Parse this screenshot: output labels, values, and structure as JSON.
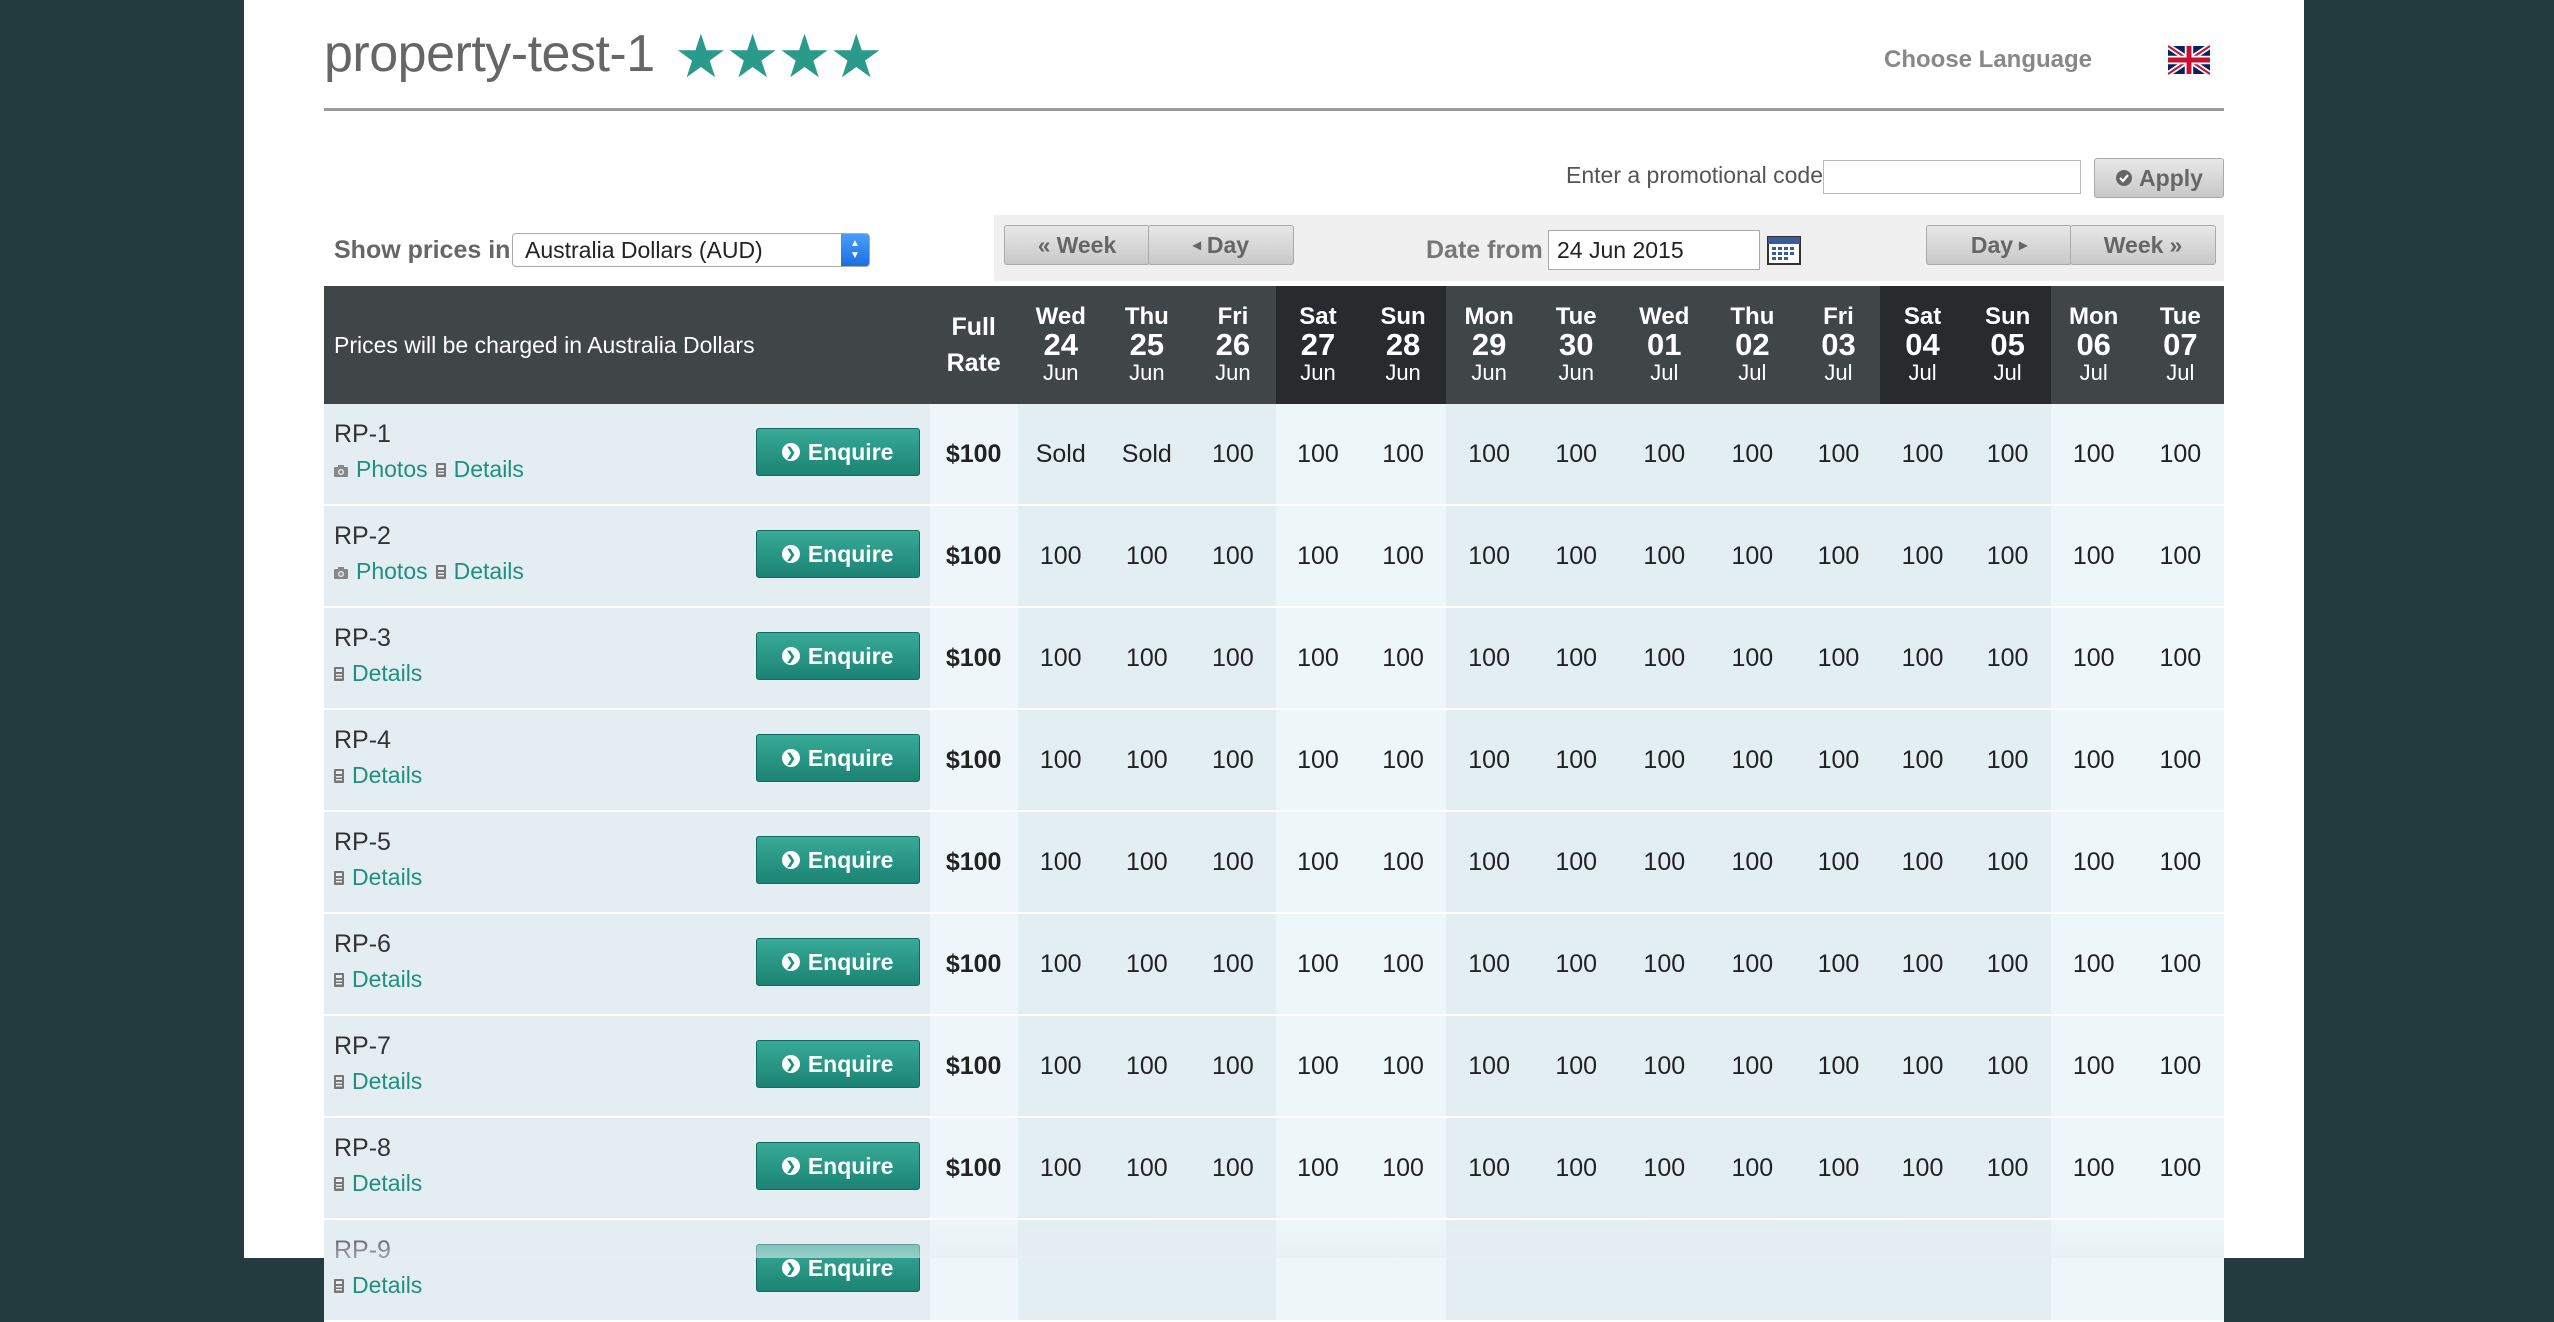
{
  "property": {
    "name": "property-test-1",
    "stars": "★★★★"
  },
  "language": {
    "label": "Choose Language",
    "flag_icon": "uk-flag-icon"
  },
  "promo": {
    "label": "Enter a promotional code",
    "value": "",
    "apply_label": "Apply"
  },
  "currency": {
    "label": "Show prices in",
    "selected": "Australia Dollars (AUD)"
  },
  "nav": {
    "week_back": "Week",
    "day_back": "Day",
    "date_from_label": "Date from",
    "date_from_value": "24 Jun 2015",
    "day_forward": "Day",
    "week_forward": "Week"
  },
  "table": {
    "notice": "Prices will be charged in Australia Dollars",
    "full_rate_label_1": "Full",
    "full_rate_label_2": "Rate",
    "dates": [
      {
        "dow": "Wed",
        "day": "24",
        "mon": "Jun",
        "weekend": false
      },
      {
        "dow": "Thu",
        "day": "25",
        "mon": "Jun",
        "weekend": false
      },
      {
        "dow": "Fri",
        "day": "26",
        "mon": "Jun",
        "weekend": false
      },
      {
        "dow": "Sat",
        "day": "27",
        "mon": "Jun",
        "weekend": true
      },
      {
        "dow": "Sun",
        "day": "28",
        "mon": "Jun",
        "weekend": true
      },
      {
        "dow": "Mon",
        "day": "29",
        "mon": "Jun",
        "weekend": false
      },
      {
        "dow": "Tue",
        "day": "30",
        "mon": "Jun",
        "weekend": false
      },
      {
        "dow": "Wed",
        "day": "01",
        "mon": "Jul",
        "weekend": false
      },
      {
        "dow": "Thu",
        "day": "02",
        "mon": "Jul",
        "weekend": false
      },
      {
        "dow": "Fri",
        "day": "03",
        "mon": "Jul",
        "weekend": false
      },
      {
        "dow": "Sat",
        "day": "04",
        "mon": "Jul",
        "weekend": true
      },
      {
        "dow": "Sun",
        "day": "05",
        "mon": "Jul",
        "weekend": true
      },
      {
        "dow": "Mon",
        "day": "06",
        "mon": "Jul",
        "weekend": false
      },
      {
        "dow": "Tue",
        "day": "07",
        "mon": "Jul",
        "weekend": false
      }
    ],
    "enquire_label": "Enquire",
    "photos_label": "Photos",
    "details_label": "Details",
    "rows": [
      {
        "name": "RP-1",
        "photos": true,
        "full_rate": "$100",
        "prices": [
          "Sold",
          "Sold",
          "100",
          "100",
          "100",
          "100",
          "100",
          "100",
          "100",
          "100",
          "100",
          "100",
          "100",
          "100"
        ]
      },
      {
        "name": "RP-2",
        "photos": true,
        "full_rate": "$100",
        "prices": [
          "100",
          "100",
          "100",
          "100",
          "100",
          "100",
          "100",
          "100",
          "100",
          "100",
          "100",
          "100",
          "100",
          "100"
        ]
      },
      {
        "name": "RP-3",
        "photos": false,
        "full_rate": "$100",
        "prices": [
          "100",
          "100",
          "100",
          "100",
          "100",
          "100",
          "100",
          "100",
          "100",
          "100",
          "100",
          "100",
          "100",
          "100"
        ]
      },
      {
        "name": "RP-4",
        "photos": false,
        "full_rate": "$100",
        "prices": [
          "100",
          "100",
          "100",
          "100",
          "100",
          "100",
          "100",
          "100",
          "100",
          "100",
          "100",
          "100",
          "100",
          "100"
        ]
      },
      {
        "name": "RP-5",
        "photos": false,
        "full_rate": "$100",
        "prices": [
          "100",
          "100",
          "100",
          "100",
          "100",
          "100",
          "100",
          "100",
          "100",
          "100",
          "100",
          "100",
          "100",
          "100"
        ]
      },
      {
        "name": "RP-6",
        "photos": false,
        "full_rate": "$100",
        "prices": [
          "100",
          "100",
          "100",
          "100",
          "100",
          "100",
          "100",
          "100",
          "100",
          "100",
          "100",
          "100",
          "100",
          "100"
        ]
      },
      {
        "name": "RP-7",
        "photos": false,
        "full_rate": "$100",
        "prices": [
          "100",
          "100",
          "100",
          "100",
          "100",
          "100",
          "100",
          "100",
          "100",
          "100",
          "100",
          "100",
          "100",
          "100"
        ]
      },
      {
        "name": "RP-8",
        "photos": false,
        "full_rate": "$100",
        "prices": [
          "100",
          "100",
          "100",
          "100",
          "100",
          "100",
          "100",
          "100",
          "100",
          "100",
          "100",
          "100",
          "100",
          "100"
        ]
      },
      {
        "name": "RP-9",
        "photos": false,
        "full_rate": "",
        "prices": [
          "",
          "",
          "",
          "",
          "",
          "",
          "",
          "",
          "",
          "",
          "",
          "",
          "",
          ""
        ]
      }
    ]
  }
}
